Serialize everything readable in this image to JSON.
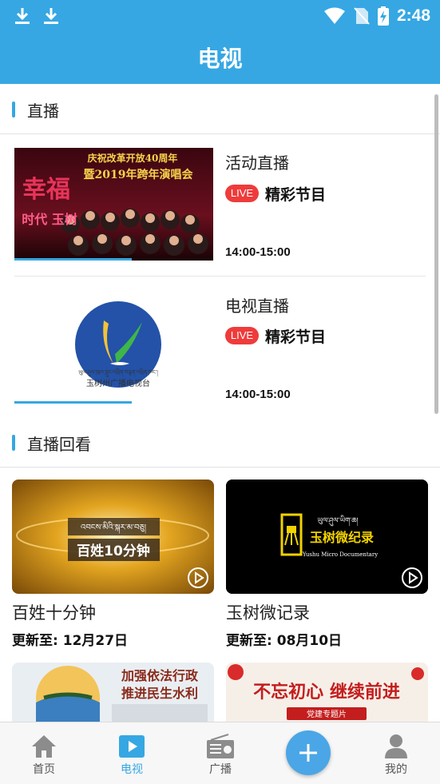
{
  "status_bar": {
    "time": "2:48"
  },
  "header": {
    "title": "电视"
  },
  "live_section": {
    "title": "直播",
    "items": [
      {
        "name": "活动直播",
        "badge": "LIVE",
        "program": "精彩节目",
        "time": "14:00-15:00",
        "poster_line1": "庆祝改革开放40周年",
        "poster_line2": "暨2019年跨年演唱会",
        "poster_big": "幸福",
        "poster_sub": "时代 玉树"
      },
      {
        "name": "电视直播",
        "badge": "LIVE",
        "program": "精彩节目",
        "time": "14:00-15:00",
        "logo_tibetan": "ཡུལ་ཤུལ་ཁུལ་རླུང་འཕྲིན་བརྙན་འཕྲིན་ཁང་།",
        "logo_text": "玉树州广播电视台"
      }
    ]
  },
  "replay_section": {
    "title": "直播回看",
    "update_prefix": "更新至:",
    "cards": [
      {
        "title": "百姓十分钟",
        "update_date": "12月27日",
        "thumb_text": "百姓10分钟",
        "thumb_tibetan": "འབངས་མིའི་སྐར་མ་བཅུ།"
      },
      {
        "title": "玉树微记录",
        "update_date": "08月10日",
        "thumb_text": "玉树微纪录",
        "thumb_tibetan": "ཡུལ་ཤུལ་ཡིག་ཆ།",
        "thumb_en": "Yushu Micro Documentary"
      },
      {
        "thumb_text_1": "加强依法行政",
        "thumb_text_2": "推进民生水利"
      },
      {
        "thumb_text": "不忘初心 继续前进",
        "thumb_sub": "党建专题片"
      }
    ]
  },
  "bottom_nav": {
    "items": [
      {
        "label": "首页",
        "icon": "home-icon"
      },
      {
        "label": "电视",
        "icon": "tv-play-icon",
        "active": true
      },
      {
        "label": "广播",
        "icon": "radio-icon"
      },
      {
        "label": "",
        "icon": "plus-icon"
      },
      {
        "label": "我的",
        "icon": "user-icon"
      }
    ]
  },
  "colors": {
    "accent": "#36a7e3",
    "live_badge": "#ef3b3b"
  }
}
